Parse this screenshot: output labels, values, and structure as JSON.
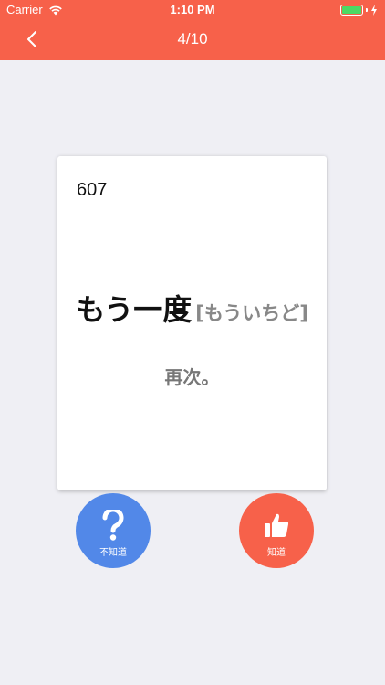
{
  "status_bar": {
    "carrier": "Carrier",
    "time": "1:10 PM",
    "battery_level": 1.0
  },
  "nav": {
    "title": "4/10"
  },
  "card": {
    "number": "607",
    "word": "もう一度",
    "reading": "[もういちど]",
    "meaning": "再次。"
  },
  "buttons": {
    "unknown_label": "不知道",
    "known_label": "知道"
  },
  "colors": {
    "accent": "#f7614a",
    "unknown_button": "#5288e8",
    "background": "#efeff4"
  },
  "icons": {
    "back": "chevron-left-icon",
    "unknown": "question-mark-icon",
    "known": "thumbs-up-icon"
  }
}
